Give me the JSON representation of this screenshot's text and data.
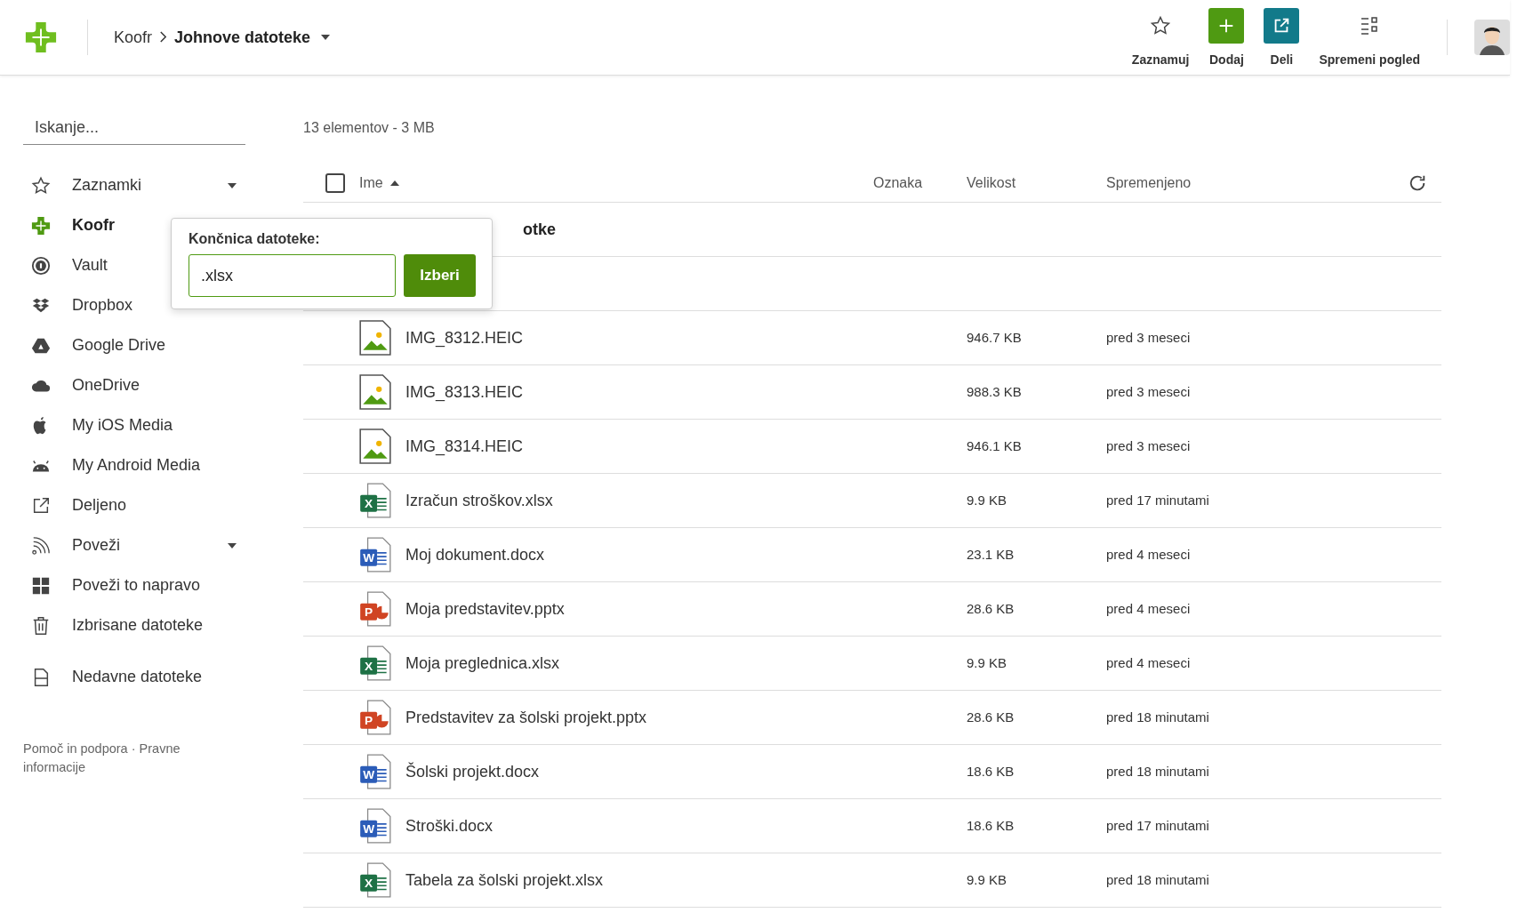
{
  "header": {
    "breadcrumb": [
      {
        "label": "Koofr",
        "current": false
      },
      {
        "label": "Johnove datoteke",
        "current": true
      }
    ],
    "actions": [
      {
        "kind": "star",
        "label": "Zaznamuj"
      },
      {
        "kind": "add",
        "label": "Dodaj"
      },
      {
        "kind": "share",
        "label": "Deli"
      },
      {
        "kind": "view",
        "label": "Spremeni pogled"
      }
    ]
  },
  "search": {
    "placeholder": "Iskanje..."
  },
  "sidebar": {
    "items": [
      {
        "kind": "star",
        "label": "Zaznamki",
        "selected": false,
        "expandable": true
      },
      {
        "kind": "koofr",
        "label": "Koofr",
        "selected": true,
        "expandable": false
      },
      {
        "kind": "vault",
        "label": "Vault",
        "selected": false,
        "expandable": false
      },
      {
        "kind": "dropbox",
        "label": "Dropbox",
        "selected": false,
        "expandable": false
      },
      {
        "kind": "gdrive",
        "label": "Google Drive",
        "selected": false,
        "expandable": false
      },
      {
        "kind": "cloud",
        "label": "OneDrive",
        "selected": false,
        "expandable": false
      },
      {
        "kind": "apple",
        "label": "My iOS Media",
        "selected": false,
        "expandable": false
      },
      {
        "kind": "android",
        "label": "My Android Media",
        "selected": false,
        "expandable": false
      },
      {
        "kind": "shared",
        "label": "Deljeno",
        "selected": false,
        "expandable": false
      },
      {
        "kind": "rss",
        "label": "Poveži",
        "selected": false,
        "expandable": true
      },
      {
        "kind": "windows",
        "label": "Poveži to napravo",
        "selected": false,
        "expandable": false
      },
      {
        "kind": "trash",
        "label": "Izbrisane datoteke",
        "selected": false,
        "expandable": false
      },
      {
        "kind": "recent",
        "label": "Nedavne datoteke",
        "selected": false,
        "expandable": false
      }
    ],
    "footer": "Pomoč in podpora · Pravne informacije"
  },
  "summary": "13 elementov - 3 MB",
  "table": {
    "select_all": {
      "checked": false
    },
    "columns": [
      "Ime",
      "Oznaka",
      "Velikost",
      "Spremenjeno"
    ],
    "rows": [
      {
        "kind": "folder-partial",
        "name": "otke"
      },
      {
        "kind": "hidden"
      },
      {
        "kind": "image",
        "name": "IMG_8312.HEIC",
        "size": "946.7 KB",
        "modified": "pred 3 meseci"
      },
      {
        "kind": "image",
        "name": "IMG_8313.HEIC",
        "size": "988.3 KB",
        "modified": "pred 3 meseci"
      },
      {
        "kind": "image",
        "name": "IMG_8314.HEIC",
        "size": "946.1 KB",
        "modified": "pred 3 meseci"
      },
      {
        "kind": "xlsx",
        "badge": "X",
        "name": "Izračun stroškov.xlsx",
        "size": "9.9 KB",
        "modified": "pred 17 minutami"
      },
      {
        "kind": "docx",
        "badge": "W",
        "name": "Moj dokument.docx",
        "size": "23.1 KB",
        "modified": "pred 4 meseci"
      },
      {
        "kind": "pptx",
        "badge": "P",
        "name": "Moja predstavitev.pptx",
        "size": "28.6 KB",
        "modified": "pred 4 meseci"
      },
      {
        "kind": "xlsx",
        "badge": "X",
        "name": "Moja preglednica.xlsx",
        "size": "9.9 KB",
        "modified": "pred 4 meseci"
      },
      {
        "kind": "pptx",
        "badge": "P",
        "name": "Predstavitev za šolski projekt.pptx",
        "size": "28.6 KB",
        "modified": "pred 18 minutami"
      },
      {
        "kind": "docx",
        "badge": "W",
        "name": "Šolski projekt.docx",
        "size": "18.6 KB",
        "modified": "pred 18 minutami"
      },
      {
        "kind": "docx",
        "badge": "W",
        "name": "Stroški.docx",
        "size": "18.6 KB",
        "modified": "pred 17 minutami"
      },
      {
        "kind": "xlsx",
        "badge": "X",
        "name": "Tabela za šolski projekt.xlsx",
        "size": "9.9 KB",
        "modified": "pred 18 minutami"
      }
    ]
  },
  "popup": {
    "label": "Končnica datoteke:",
    "value": ".xlsx",
    "button": "Izberi"
  }
}
